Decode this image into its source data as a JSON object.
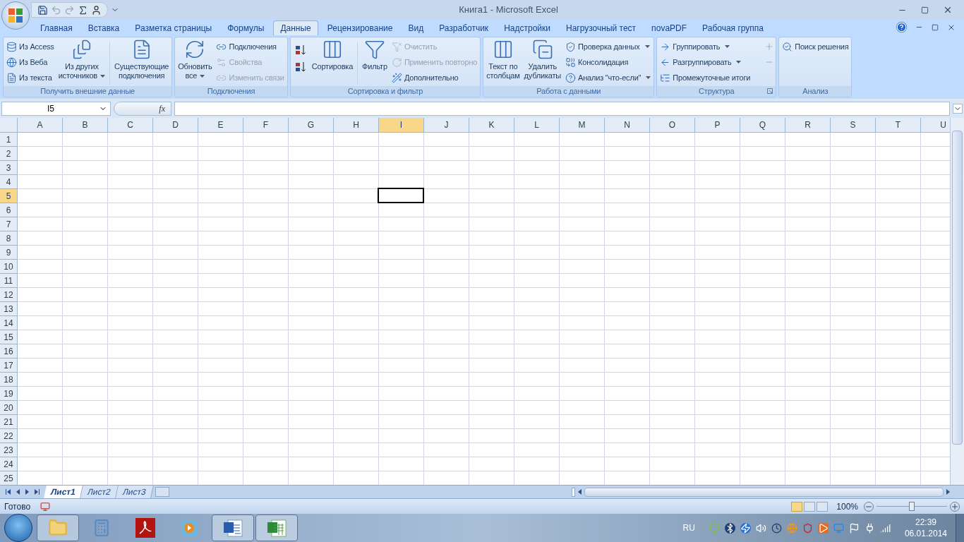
{
  "window": {
    "title": "Книга1 - Microsoft Excel"
  },
  "tabs": [
    {
      "label": "Главная",
      "selected": false
    },
    {
      "label": "Вставка",
      "selected": false
    },
    {
      "label": "Разметка страницы",
      "selected": false
    },
    {
      "label": "Формулы",
      "selected": false
    },
    {
      "label": "Данные",
      "selected": true
    },
    {
      "label": "Рецензирование",
      "selected": false
    },
    {
      "label": "Вид",
      "selected": false
    },
    {
      "label": "Разработчик",
      "selected": false
    },
    {
      "label": "Надстройки",
      "selected": false
    },
    {
      "label": "Нагрузочный тест",
      "selected": false
    },
    {
      "label": "novaPDF",
      "selected": false
    },
    {
      "label": "Рабочая группа",
      "selected": false
    }
  ],
  "ribbon": {
    "groups": [
      {
        "title": "Получить внешние данные",
        "launcher": false,
        "columns": [
          {
            "kind": "stack",
            "items": [
              {
                "label": "Из Access",
                "disabled": false,
                "dropdown": false
              },
              {
                "label": "Из Веба",
                "disabled": false,
                "dropdown": false
              },
              {
                "label": "Из текста",
                "disabled": false,
                "dropdown": false
              }
            ]
          },
          {
            "kind": "large",
            "label": "Из других\nисточников",
            "disabled": false,
            "dropdown": true
          },
          {
            "kind": "separator"
          },
          {
            "kind": "large",
            "label": "Существующие\nподключения",
            "disabled": false,
            "dropdown": false
          }
        ]
      },
      {
        "title": "Подключения",
        "launcher": false,
        "columns": [
          {
            "kind": "large",
            "label": "Обновить\nвсе",
            "disabled": false,
            "dropdown": true
          },
          {
            "kind": "stack",
            "items": [
              {
                "label": "Подключения",
                "disabled": false,
                "dropdown": false
              },
              {
                "label": "Свойства",
                "disabled": true,
                "dropdown": false
              },
              {
                "label": "Изменить связи",
                "disabled": true,
                "dropdown": false
              }
            ]
          }
        ]
      },
      {
        "title": "Сортировка и фильтр",
        "launcher": false,
        "columns": [
          {
            "kind": "sort"
          },
          {
            "kind": "large",
            "label": "Сортировка",
            "disabled": false,
            "dropdown": false
          },
          {
            "kind": "separator"
          },
          {
            "kind": "large",
            "label": "Фильтр",
            "disabled": false,
            "dropdown": false
          },
          {
            "kind": "stack",
            "items": [
              {
                "label": "Очистить",
                "disabled": true,
                "dropdown": false
              },
              {
                "label": "Применить повторно",
                "disabled": true,
                "dropdown": false
              },
              {
                "label": "Дополнительно",
                "disabled": false,
                "dropdown": false
              }
            ]
          }
        ]
      },
      {
        "title": "Работа с данными",
        "launcher": false,
        "columns": [
          {
            "kind": "large",
            "label": "Текст по\nстолбцам",
            "disabled": false,
            "dropdown": false
          },
          {
            "kind": "large",
            "label": "Удалить\nдубликаты",
            "disabled": false,
            "dropdown": false
          },
          {
            "kind": "stack",
            "items": [
              {
                "label": "Проверка данных",
                "disabled": false,
                "dropdown": true
              },
              {
                "label": "Консолидация",
                "disabled": false,
                "dropdown": false
              },
              {
                "label": "Анализ \"что-если\"",
                "disabled": false,
                "dropdown": true
              }
            ]
          }
        ]
      },
      {
        "title": "Структура",
        "launcher": true,
        "columns": [
          {
            "kind": "stack",
            "items": [
              {
                "label": "Группировать",
                "disabled": false,
                "dropdown": true
              },
              {
                "label": "Разгруппировать",
                "disabled": false,
                "dropdown": true
              },
              {
                "label": "Промежуточные итоги",
                "disabled": false,
                "dropdown": false
              }
            ]
          },
          {
            "kind": "detail"
          }
        ]
      },
      {
        "title": "Анализ",
        "launcher": false,
        "columns": [
          {
            "kind": "stack",
            "items": [
              {
                "label": "Поиск решения",
                "disabled": false,
                "dropdown": false
              }
            ]
          }
        ]
      }
    ]
  },
  "formula_bar": {
    "name_box": "I5",
    "fx": "fx"
  },
  "sheet": {
    "columns": [
      {
        "label": "A",
        "selected": false
      },
      {
        "label": "B",
        "selected": false
      },
      {
        "label": "C",
        "selected": false
      },
      {
        "label": "D",
        "selected": false
      },
      {
        "label": "E",
        "selected": false
      },
      {
        "label": "F",
        "selected": false
      },
      {
        "label": "G",
        "selected": false
      },
      {
        "label": "H",
        "selected": false
      },
      {
        "label": "I",
        "selected": true
      },
      {
        "label": "J",
        "selected": false
      },
      {
        "label": "K",
        "selected": false
      },
      {
        "label": "L",
        "selected": false
      },
      {
        "label": "M",
        "selected": false
      },
      {
        "label": "N",
        "selected": false
      },
      {
        "label": "O",
        "selected": false
      },
      {
        "label": "P",
        "selected": false
      },
      {
        "label": "Q",
        "selected": false
      },
      {
        "label": "R",
        "selected": false
      },
      {
        "label": "S",
        "selected": false
      },
      {
        "label": "T",
        "selected": false
      },
      {
        "label": "U",
        "selected": false
      }
    ],
    "rows": [
      {
        "label": "1",
        "selected": false
      },
      {
        "label": "2",
        "selected": false
      },
      {
        "label": "3",
        "selected": false
      },
      {
        "label": "4",
        "selected": false
      },
      {
        "label": "5",
        "selected": true
      },
      {
        "label": "6",
        "selected": false
      },
      {
        "label": "7",
        "selected": false
      },
      {
        "label": "8",
        "selected": false
      },
      {
        "label": "9",
        "selected": false
      },
      {
        "label": "10",
        "selected": false
      },
      {
        "label": "11",
        "selected": false
      },
      {
        "label": "12",
        "selected": false
      },
      {
        "label": "13",
        "selected": false
      },
      {
        "label": "14",
        "selected": false
      },
      {
        "label": "15",
        "selected": false
      },
      {
        "label": "16",
        "selected": false
      },
      {
        "label": "17",
        "selected": false
      },
      {
        "label": "18",
        "selected": false
      },
      {
        "label": "19",
        "selected": false
      },
      {
        "label": "20",
        "selected": false
      },
      {
        "label": "21",
        "selected": false
      },
      {
        "label": "22",
        "selected": false
      },
      {
        "label": "23",
        "selected": false
      },
      {
        "label": "24",
        "selected": false
      },
      {
        "label": "25",
        "selected": false
      }
    ]
  },
  "sheet_tabs": [
    {
      "label": "Лист1",
      "selected": true
    },
    {
      "label": "Лист2",
      "selected": false
    },
    {
      "label": "Лист3",
      "selected": false
    }
  ],
  "status_bar": {
    "status": "Готово",
    "zoom": "100%",
    "zoom_slider": {
      "level": 0.5
    }
  },
  "taskbar": {
    "apps": [
      {
        "kind": "folder",
        "open": true
      },
      {
        "kind": "calculator",
        "open": false
      },
      {
        "kind": "pdf",
        "open": false
      },
      {
        "kind": "media",
        "open": false
      },
      {
        "kind": "word",
        "open": true
      },
      {
        "kind": "excel",
        "open": true
      }
    ],
    "language": "RU",
    "time": "22:39",
    "date": "06.01.2014"
  }
}
